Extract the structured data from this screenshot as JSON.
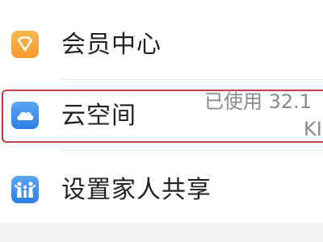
{
  "menu": {
    "items": [
      {
        "label": "会员中心",
        "icon": "diamond-icon",
        "color": "#f4a43a"
      },
      {
        "label": "云空间",
        "icon": "cloud-icon",
        "color": "#3d8ee8"
      },
      {
        "label": "设置家人共享",
        "icon": "family-icon",
        "color": "#3d8ee8"
      }
    ],
    "cloud_usage_line1": "已使用 32.1",
    "cloud_usage_line2": "KI"
  },
  "highlight_color": "#c73b46",
  "background_color": "#f1f1f1"
}
